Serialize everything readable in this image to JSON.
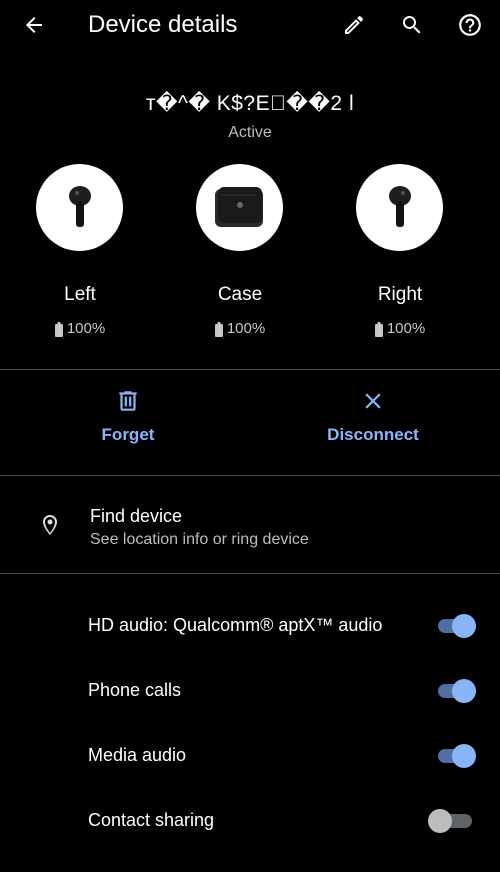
{
  "appbar": {
    "title": "Device details",
    "back_icon": "arrow-left-icon",
    "edit_icon": "pencil-icon",
    "search_icon": "search-icon",
    "help_icon": "help-circle-icon"
  },
  "device": {
    "name": "т�^� K$?E\u0000��2 l",
    "status": "Active"
  },
  "components": [
    {
      "label": "Left",
      "battery": "100%",
      "icon": "earbud-icon"
    },
    {
      "label": "Case",
      "battery": "100%",
      "icon": "charging-case-icon"
    },
    {
      "label": "Right",
      "battery": "100%",
      "icon": "earbud-icon"
    }
  ],
  "actions": {
    "forget_label": "Forget",
    "forget_icon": "trash-icon",
    "disconnect_label": "Disconnect",
    "disconnect_icon": "close-icon"
  },
  "find_device": {
    "title": "Find device",
    "subtitle": "See location info or ring device",
    "icon": "location-pin-icon"
  },
  "toggles": [
    {
      "label": "HD audio: Qualcomm® aptX™ audio",
      "on": true
    },
    {
      "label": "Phone calls",
      "on": true
    },
    {
      "label": "Media audio",
      "on": true
    },
    {
      "label": "Contact sharing",
      "on": false
    }
  ],
  "colors": {
    "background": "#000000",
    "accent": "#8ab4f8",
    "accent_track": "#4e6fa6",
    "divider": "#4a4a4a"
  }
}
